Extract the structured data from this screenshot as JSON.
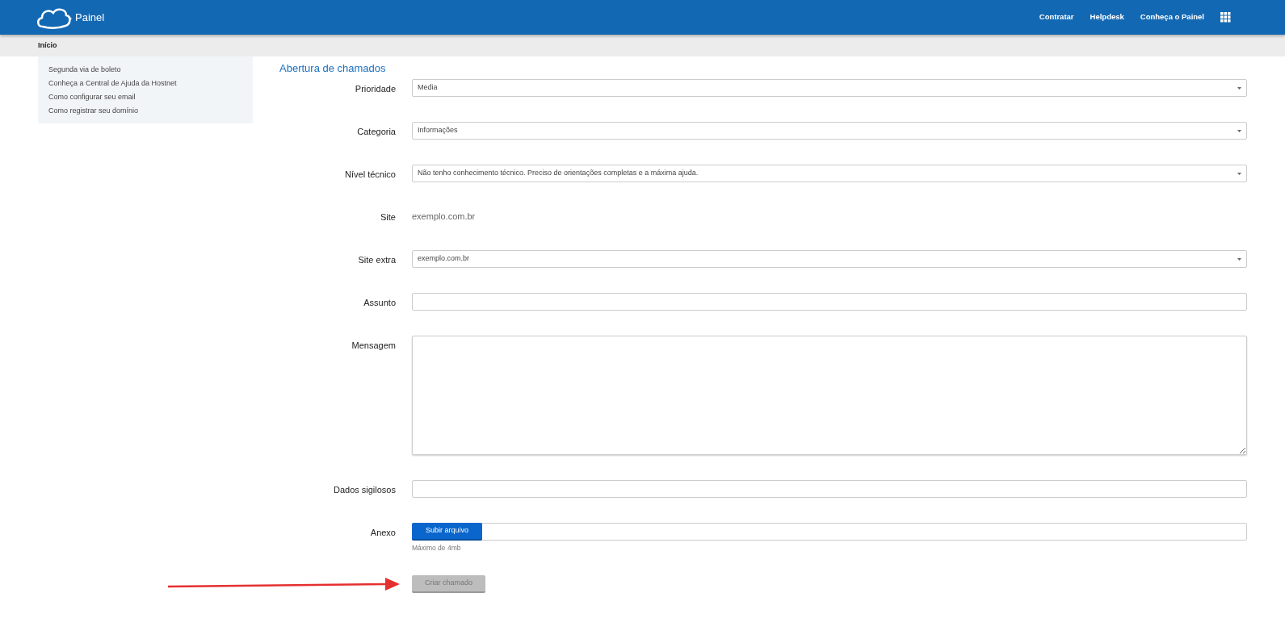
{
  "header": {
    "brand": "Painel",
    "nav": [
      "Contratar",
      "Helpdesk",
      "Conheça o Painel"
    ]
  },
  "breadcrumb": "Início",
  "sidebar": {
    "items": [
      "Segunda via de boleto",
      "Conheça a Central de Ajuda da Hostnet",
      "Como configurar seu email",
      "Como registrar seu domínio"
    ]
  },
  "form": {
    "title": "Abertura de chamados",
    "fields": [
      {
        "kind": "select",
        "label": "Prioridade",
        "value": "Media"
      },
      {
        "kind": "select",
        "label": "Categoria",
        "value": "Informações"
      },
      {
        "kind": "select",
        "label": "Nível técnico",
        "value": "Não tenho conhecimento técnico. Preciso de orientações completas e a máxima ajuda."
      },
      {
        "kind": "text",
        "label": "Site",
        "value": "exemplo.com.br"
      },
      {
        "kind": "select",
        "label": "Site extra",
        "value": "exemplo.com.br"
      },
      {
        "kind": "input",
        "label": "Assunto"
      },
      {
        "kind": "textarea",
        "label": "Mensagem"
      },
      {
        "kind": "input",
        "label": "Dados sigilosos"
      },
      {
        "kind": "file",
        "label": "Anexo",
        "button": "Subir arquivo",
        "hint": "Máximo de 4mb"
      }
    ],
    "submit": {
      "label": "Criar chamado",
      "disabled": true
    }
  }
}
